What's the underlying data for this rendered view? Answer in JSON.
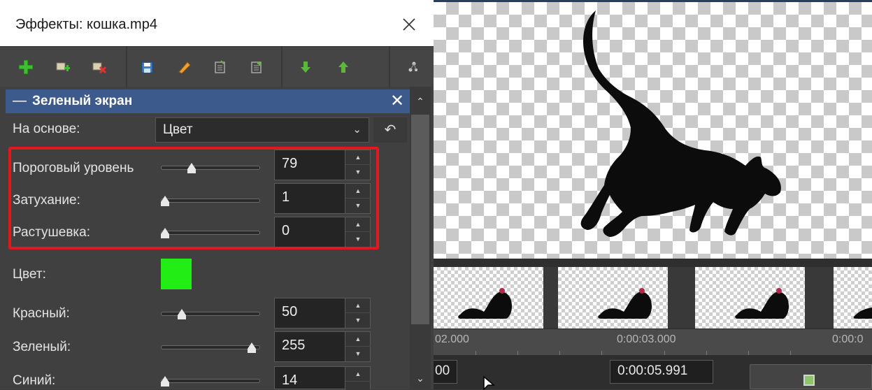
{
  "dialog": {
    "title": "Эффекты: кошка.mp4",
    "toolbar": [
      "add-effect-icon",
      "add-preset-icon",
      "remove-effect-icon",
      "save-icon",
      "edit-icon",
      "copy-icon",
      "paste-icon",
      "move-down-icon",
      "move-up-icon",
      "settings-icon"
    ]
  },
  "effect": {
    "name": "Зеленый экран",
    "base_label": "На основе:",
    "base_value": "Цвет",
    "threshold": {
      "label": "Пороговый уровень",
      "value": "79",
      "level_fraction": 0.31
    },
    "fade": {
      "label": "Затухание:",
      "value": "1",
      "level_fraction": 0.0
    },
    "feather": {
      "label": "Растушевка:",
      "value": "0",
      "level_fraction": 0.0
    },
    "color_label": "Цвет:",
    "color_hex": "#22ee16",
    "red": {
      "label": "Красный:",
      "value": "50",
      "level_fraction": 0.2
    },
    "green": {
      "label": "Зеленый:",
      "value": "255",
      "level_fraction": 1.0
    },
    "blue": {
      "label": "Синий:",
      "value": "14",
      "level_fraction": 0.05
    }
  },
  "timeline": {
    "ruler_labels": [
      "02.000",
      "0:00:03.000",
      "0:00:0"
    ],
    "time_left": "00",
    "time_current": "0:00:05.991"
  },
  "colors": {
    "accent_header": "#3d5a8c",
    "highlight": "#e3181c"
  }
}
